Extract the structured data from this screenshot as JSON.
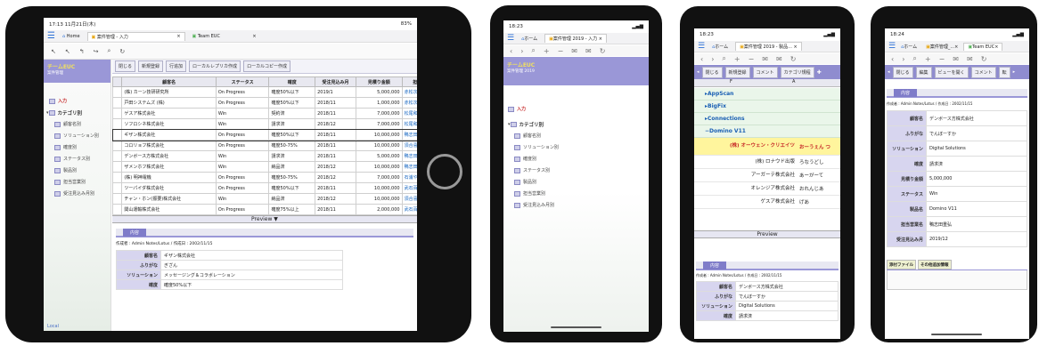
{
  "tablet": {
    "status": {
      "time": "17:13 11月21日(木)",
      "right": "83%"
    },
    "tabs": [
      {
        "label": "Home",
        "active": false
      },
      {
        "label": "案件管理 - 入力",
        "active": true,
        "close": "×"
      },
      {
        "label": "Team EUC",
        "active": false,
        "close": "×"
      }
    ],
    "app_title": "チームEUC",
    "app_sub": "案件管理",
    "sidebar": [
      {
        "label": "入力",
        "type": "red"
      },
      {
        "label": "カテゴリ別",
        "type": "category"
      },
      {
        "label": "顧客名別",
        "type": "item"
      },
      {
        "label": "ソリューション別",
        "type": "item"
      },
      {
        "label": "確度別",
        "type": "item"
      },
      {
        "label": "ステータス別",
        "type": "item"
      },
      {
        "label": "製品別",
        "type": "item"
      },
      {
        "label": "担当営業別",
        "type": "item"
      },
      {
        "label": "受注見込み月別",
        "type": "item"
      }
    ],
    "toolbar": [
      "閉じる",
      "新規登録",
      "行追加",
      "ローカルレプリカ作成",
      "ローカルコピー作成"
    ],
    "columns": [
      "顧客名",
      "ステータス",
      "確度",
      "受注見込み月",
      "見積り金額",
      "担当"
    ],
    "rows": [
      [
        "(株) カーン技研研究所",
        "On Progress",
        "確度50%以下",
        "2019/1",
        "5,000,000",
        "赤松次"
      ],
      [
        "戸田システムズ (株)",
        "On Progress",
        "確度50%以下",
        "2018/11",
        "1,000,000",
        "赤松次"
      ],
      [
        "ゲスア株式会社",
        "Win",
        "契約済",
        "2018/11",
        "7,000,000",
        "松尾和"
      ],
      [
        "ソフロシネ株式会社",
        "Win",
        "請求済",
        "2018/12",
        "7,000,000",
        "松尾和"
      ],
      [
        "ギザン株式会社",
        "On Progress",
        "確度50%以下",
        "2018/11",
        "10,000,000",
        "鴨志田"
      ],
      [
        "コロリョフ株式会社",
        "On Progress",
        "確度50-75%",
        "2018/11",
        "10,000,000",
        "須合喜"
      ],
      [
        "デンボース方株式会社",
        "Win",
        "請求済",
        "2018/11",
        "5,000,000",
        "鴨志田"
      ],
      [
        "ザメンホフ株式会社",
        "Win",
        "納品済",
        "2018/12",
        "10,000,000",
        "鴨志田"
      ],
      [
        "(株) 明神電機",
        "On Progress",
        "確度50-75%",
        "2018/12",
        "7,000,000",
        "石浦や"
      ],
      [
        "ツーパイダ株式会社",
        "On Progress",
        "確度50%以下",
        "2018/11",
        "10,000,000",
        "武石百"
      ],
      [
        "チャン・ホン(振要)株式会社",
        "Win",
        "納品済",
        "2018/12",
        "10,000,000",
        "須合喜"
      ],
      [
        "関山運輸株式会社",
        "On Progress",
        "確度75%以上",
        "2018/11",
        "2,000,000",
        "武石百"
      ]
    ],
    "preview_label": "Preview ▼",
    "detail": {
      "tag": "内容",
      "meta": "作成者 : Admin Notes/Lotus / 作成日 : 2002/11/15",
      "fields": [
        {
          "k": "顧客名",
          "v": "ギザン株式会社"
        },
        {
          "k": "ふりがな",
          "v": "ぎざん"
        },
        {
          "k": "ソリューション",
          "v": "メッセージング＆コラボレーション"
        },
        {
          "k": "確度",
          "v": "確度50%以下"
        }
      ]
    },
    "footer": "Local"
  },
  "phone1": {
    "time": "18:23",
    "tabs": [
      "ホーム",
      "案件管理 2019 - 入力"
    ],
    "close": "×",
    "app_title": "チームEUC",
    "app_sub": "案件管理 2019",
    "sidebar": [
      {
        "label": "入力",
        "type": "red"
      },
      {
        "label": "カテゴリ別",
        "type": "category"
      },
      {
        "label": "顧客名別",
        "type": "item"
      },
      {
        "label": "ソリューション別",
        "type": "item"
      },
      {
        "label": "確度別",
        "type": "item"
      },
      {
        "label": "ステータス別",
        "type": "item"
      },
      {
        "label": "製品別",
        "type": "item"
      },
      {
        "label": "担当営業別",
        "type": "item"
      },
      {
        "label": "受注見込み月別",
        "type": "item"
      }
    ]
  },
  "phone2": {
    "time": "18:23",
    "tabs": [
      "ホーム",
      "案件管理 2019 - 製品..."
    ],
    "close": "×",
    "toolbar": [
      "閉じる",
      "新規登録",
      "コメント",
      "カテゴリ規程"
    ],
    "col_headers": [
      "F",
      "A"
    ],
    "categories": [
      "AppScan",
      "BigFix",
      "Connections",
      "Domino V11"
    ],
    "rows": [
      {
        "name": "(株) オーウェン・クリエイツ",
        "kana": "おーうぇん つ",
        "highlight": true
      },
      {
        "name": "(株) ロナウド出版",
        "kana": "ろなうどし",
        "highlight": false
      },
      {
        "name": "アーガーテ株式会社",
        "kana": "あーがーて",
        "highlight": false
      },
      {
        "name": "オレンジア株式会社",
        "kana": "おれんじあ",
        "highlight": false
      },
      {
        "name": "ゲスア株式会社",
        "kana": "げあ",
        "highlight": false
      }
    ],
    "preview_label": "Preview",
    "detail": {
      "tag": "内容",
      "meta": "作成者 : Admin Notes/Lotus / 作成日 : 2002/11/15",
      "fields": [
        {
          "k": "顧客名",
          "v": "デンボース方株式会社"
        },
        {
          "k": "ふりがな",
          "v": "でんぼーすか"
        },
        {
          "k": "ソリューション",
          "v": "Digital Solutions"
        },
        {
          "k": "確度",
          "v": "請求済"
        }
      ]
    }
  },
  "phone3": {
    "time": "18:24",
    "tabs": [
      "ホーム",
      "案件管理_...",
      "Team EUC"
    ],
    "close": "×",
    "toolbar": [
      "閉じる",
      "編集",
      "ビューを開く",
      "コメント",
      "転"
    ],
    "detail": {
      "tag": "内容",
      "meta": "作成者 : Admin Notes/Lotus / 作成日 : 2002/11/15",
      "fields": [
        {
          "k": "顧客名",
          "v": "デンボース方株式会社"
        },
        {
          "k": "ふりがな",
          "v": "でんぼーすか"
        },
        {
          "k": "ソリューション",
          "v": "Digital Solutions"
        },
        {
          "k": "確度",
          "v": "請求済"
        },
        {
          "k": "見積り金額",
          "v": "5,000,000"
        },
        {
          "k": "ステータス",
          "v": "Win"
        },
        {
          "k": "製品名",
          "v": "Domino V11"
        },
        {
          "k": "担当営業名",
          "v": "鴨志田重弘"
        },
        {
          "k": "受注見込み月",
          "v": "2019/12"
        }
      ],
      "tabs": [
        "添付ファイル",
        "その他追加情報"
      ]
    }
  },
  "colors": {
    "accent": "#9a97d7",
    "frame": "#111111",
    "link": "#1565c0",
    "highlight": "#fff59d"
  }
}
